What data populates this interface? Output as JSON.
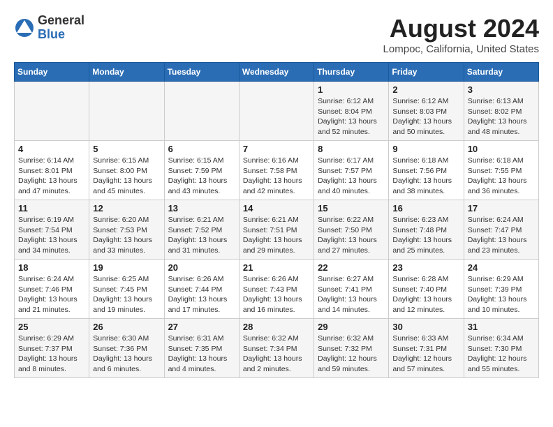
{
  "logo": {
    "general": "General",
    "blue": "Blue"
  },
  "header": {
    "month": "August 2024",
    "location": "Lompoc, California, United States"
  },
  "weekdays": [
    "Sunday",
    "Monday",
    "Tuesday",
    "Wednesday",
    "Thursday",
    "Friday",
    "Saturday"
  ],
  "weeks": [
    [
      {
        "day": "",
        "info": ""
      },
      {
        "day": "",
        "info": ""
      },
      {
        "day": "",
        "info": ""
      },
      {
        "day": "",
        "info": ""
      },
      {
        "day": "1",
        "info": "Sunrise: 6:12 AM\nSunset: 8:04 PM\nDaylight: 13 hours\nand 52 minutes."
      },
      {
        "day": "2",
        "info": "Sunrise: 6:12 AM\nSunset: 8:03 PM\nDaylight: 13 hours\nand 50 minutes."
      },
      {
        "day": "3",
        "info": "Sunrise: 6:13 AM\nSunset: 8:02 PM\nDaylight: 13 hours\nand 48 minutes."
      }
    ],
    [
      {
        "day": "4",
        "info": "Sunrise: 6:14 AM\nSunset: 8:01 PM\nDaylight: 13 hours\nand 47 minutes."
      },
      {
        "day": "5",
        "info": "Sunrise: 6:15 AM\nSunset: 8:00 PM\nDaylight: 13 hours\nand 45 minutes."
      },
      {
        "day": "6",
        "info": "Sunrise: 6:15 AM\nSunset: 7:59 PM\nDaylight: 13 hours\nand 43 minutes."
      },
      {
        "day": "7",
        "info": "Sunrise: 6:16 AM\nSunset: 7:58 PM\nDaylight: 13 hours\nand 42 minutes."
      },
      {
        "day": "8",
        "info": "Sunrise: 6:17 AM\nSunset: 7:57 PM\nDaylight: 13 hours\nand 40 minutes."
      },
      {
        "day": "9",
        "info": "Sunrise: 6:18 AM\nSunset: 7:56 PM\nDaylight: 13 hours\nand 38 minutes."
      },
      {
        "day": "10",
        "info": "Sunrise: 6:18 AM\nSunset: 7:55 PM\nDaylight: 13 hours\nand 36 minutes."
      }
    ],
    [
      {
        "day": "11",
        "info": "Sunrise: 6:19 AM\nSunset: 7:54 PM\nDaylight: 13 hours\nand 34 minutes."
      },
      {
        "day": "12",
        "info": "Sunrise: 6:20 AM\nSunset: 7:53 PM\nDaylight: 13 hours\nand 33 minutes."
      },
      {
        "day": "13",
        "info": "Sunrise: 6:21 AM\nSunset: 7:52 PM\nDaylight: 13 hours\nand 31 minutes."
      },
      {
        "day": "14",
        "info": "Sunrise: 6:21 AM\nSunset: 7:51 PM\nDaylight: 13 hours\nand 29 minutes."
      },
      {
        "day": "15",
        "info": "Sunrise: 6:22 AM\nSunset: 7:50 PM\nDaylight: 13 hours\nand 27 minutes."
      },
      {
        "day": "16",
        "info": "Sunrise: 6:23 AM\nSunset: 7:48 PM\nDaylight: 13 hours\nand 25 minutes."
      },
      {
        "day": "17",
        "info": "Sunrise: 6:24 AM\nSunset: 7:47 PM\nDaylight: 13 hours\nand 23 minutes."
      }
    ],
    [
      {
        "day": "18",
        "info": "Sunrise: 6:24 AM\nSunset: 7:46 PM\nDaylight: 13 hours\nand 21 minutes."
      },
      {
        "day": "19",
        "info": "Sunrise: 6:25 AM\nSunset: 7:45 PM\nDaylight: 13 hours\nand 19 minutes."
      },
      {
        "day": "20",
        "info": "Sunrise: 6:26 AM\nSunset: 7:44 PM\nDaylight: 13 hours\nand 17 minutes."
      },
      {
        "day": "21",
        "info": "Sunrise: 6:26 AM\nSunset: 7:43 PM\nDaylight: 13 hours\nand 16 minutes."
      },
      {
        "day": "22",
        "info": "Sunrise: 6:27 AM\nSunset: 7:41 PM\nDaylight: 13 hours\nand 14 minutes."
      },
      {
        "day": "23",
        "info": "Sunrise: 6:28 AM\nSunset: 7:40 PM\nDaylight: 13 hours\nand 12 minutes."
      },
      {
        "day": "24",
        "info": "Sunrise: 6:29 AM\nSunset: 7:39 PM\nDaylight: 13 hours\nand 10 minutes."
      }
    ],
    [
      {
        "day": "25",
        "info": "Sunrise: 6:29 AM\nSunset: 7:37 PM\nDaylight: 13 hours\nand 8 minutes."
      },
      {
        "day": "26",
        "info": "Sunrise: 6:30 AM\nSunset: 7:36 PM\nDaylight: 13 hours\nand 6 minutes."
      },
      {
        "day": "27",
        "info": "Sunrise: 6:31 AM\nSunset: 7:35 PM\nDaylight: 13 hours\nand 4 minutes."
      },
      {
        "day": "28",
        "info": "Sunrise: 6:32 AM\nSunset: 7:34 PM\nDaylight: 13 hours\nand 2 minutes."
      },
      {
        "day": "29",
        "info": "Sunrise: 6:32 AM\nSunset: 7:32 PM\nDaylight: 12 hours\nand 59 minutes."
      },
      {
        "day": "30",
        "info": "Sunrise: 6:33 AM\nSunset: 7:31 PM\nDaylight: 12 hours\nand 57 minutes."
      },
      {
        "day": "31",
        "info": "Sunrise: 6:34 AM\nSunset: 7:30 PM\nDaylight: 12 hours\nand 55 minutes."
      }
    ]
  ]
}
